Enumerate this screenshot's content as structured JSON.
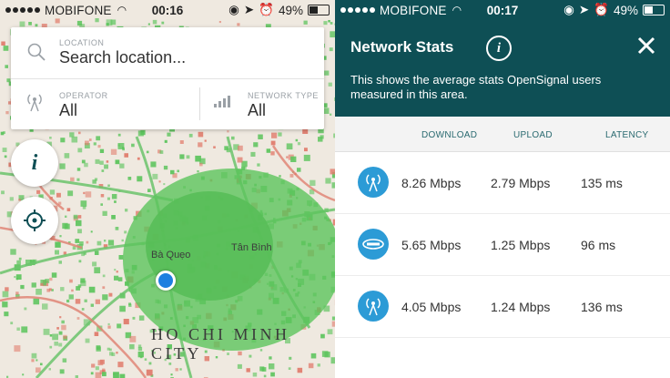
{
  "left": {
    "status": {
      "carrier": "MOBIFONE",
      "time": "00:16",
      "battery": "49%"
    },
    "search": {
      "location_label": "LOCATION",
      "location_placeholder": "Search location..."
    },
    "operator": {
      "label": "OPERATOR",
      "value": "All"
    },
    "network_type": {
      "label": "NETWORK TYPE",
      "value": "All"
    },
    "map": {
      "places": [
        "Bà Quẹo",
        "Tân Bình"
      ],
      "city": "HO CHI MINH CITY",
      "colors": {
        "good": "#5cc45c",
        "bad": "#e07a6a",
        "land": "#efe9e0"
      }
    }
  },
  "right": {
    "status": {
      "carrier": "MOBIFONE",
      "time": "00:17",
      "battery": "49%"
    },
    "header": {
      "title": "Network Stats",
      "description": "This shows the average stats OpenSignal users measured in this area.",
      "color": "#0e4f55"
    },
    "columns": [
      "DOWNLOAD",
      "UPLOAD",
      "LATENCY"
    ],
    "rows": [
      {
        "icon": "signal-tower-icon",
        "download": "8.26 Mbps",
        "upload": "2.79 Mbps",
        "latency": "135 ms"
      },
      {
        "icon": "operator-logo-icon",
        "download": "5.65 Mbps",
        "upload": "1.25 Mbps",
        "latency": "96 ms"
      },
      {
        "icon": "signal-tower-icon",
        "download": "4.05 Mbps",
        "upload": "1.24 Mbps",
        "latency": "136 ms"
      }
    ]
  }
}
